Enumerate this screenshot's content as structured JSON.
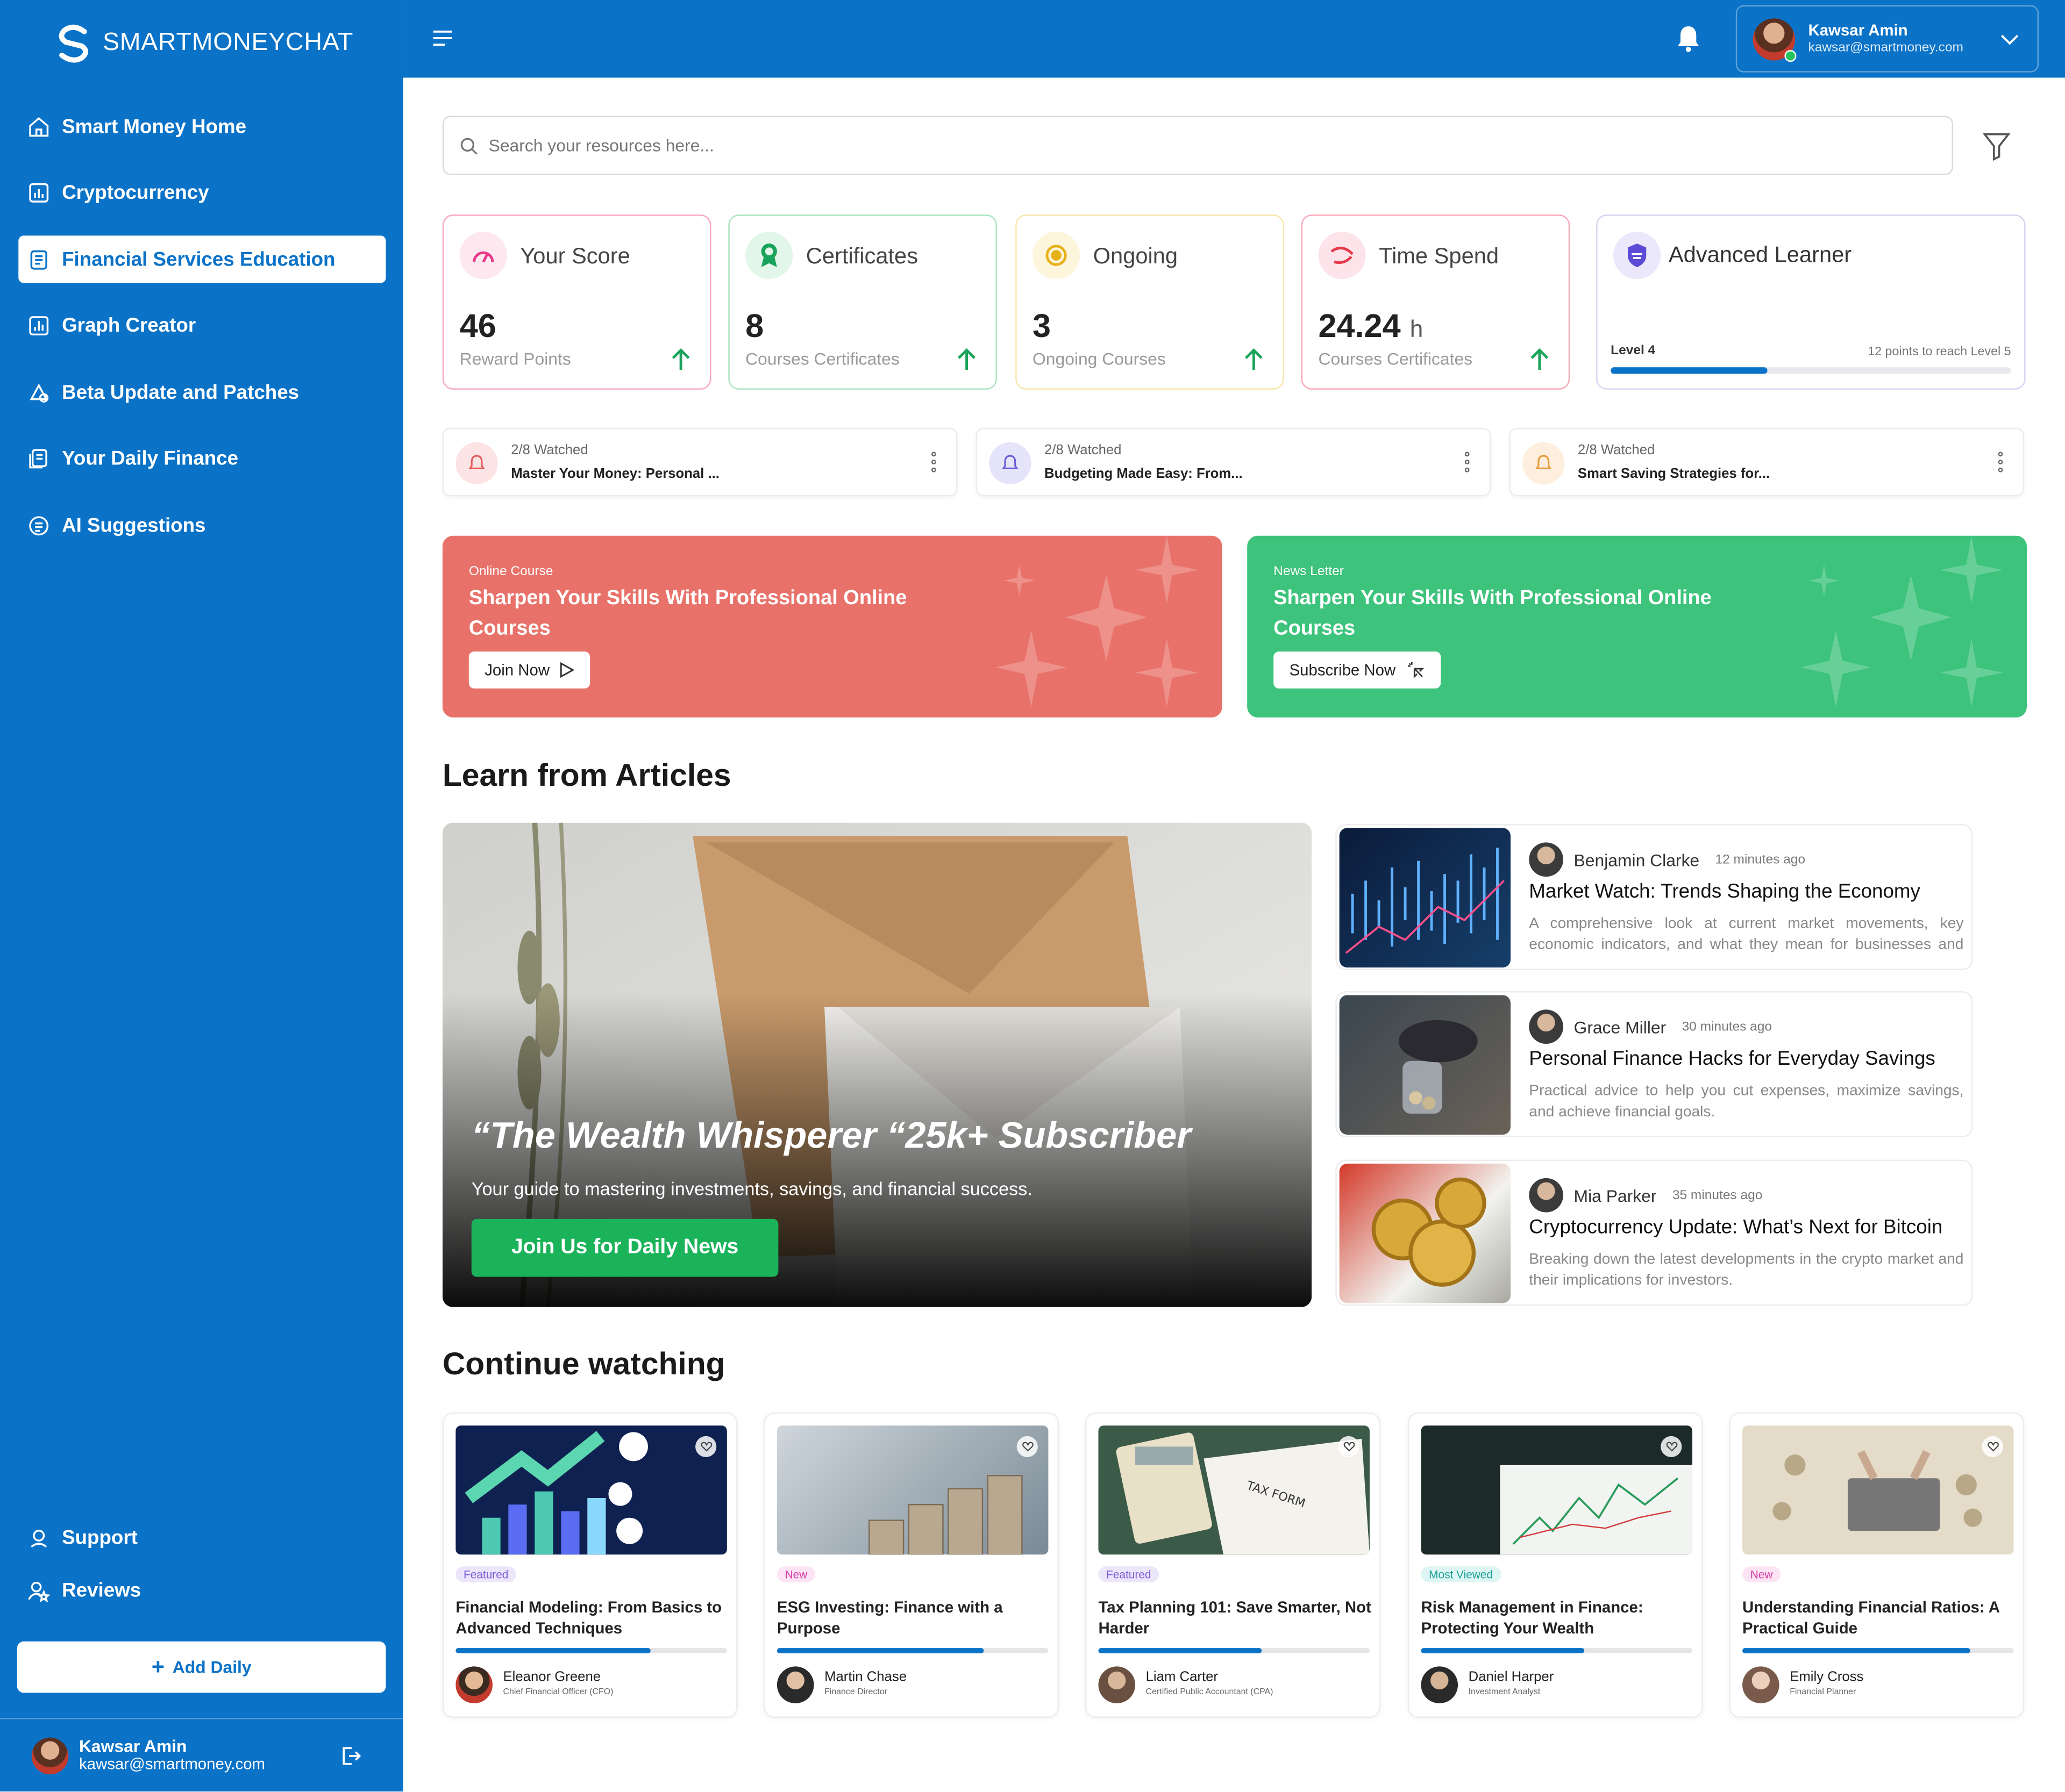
{
  "brand": {
    "name": "SMARTMONEYCHAT"
  },
  "sidebar": {
    "items": [
      {
        "label": "Smart Money Home",
        "icon": "home-icon"
      },
      {
        "label": "Cryptocurrency",
        "icon": "chart-icon"
      },
      {
        "label": "Financial Services Education",
        "icon": "document-icon",
        "active": true
      },
      {
        "label": "Graph Creator",
        "icon": "graph-icon"
      },
      {
        "label": "Beta Update and Patches",
        "icon": "patch-icon"
      },
      {
        "label": "Your Daily Finance",
        "icon": "finance-icon"
      },
      {
        "label": "AI Suggestions",
        "icon": "list-icon"
      }
    ],
    "bottom": [
      {
        "label": "Support",
        "icon": "support-icon"
      },
      {
        "label": "Reviews",
        "icon": "reviews-icon"
      }
    ],
    "add_daily": "Add Daily",
    "user": {
      "name": "Kawsar Amin",
      "email": "kawsar@smartmoney.com"
    }
  },
  "topbar": {
    "user": {
      "name": "Kawsar Amin",
      "email": "kawsar@smartmoney.com"
    }
  },
  "search": {
    "placeholder": "Search your resources here..."
  },
  "stats": [
    {
      "title": "Your Score",
      "value": "46",
      "unit": "",
      "sub": "Reward Points",
      "color": "#f7a8c0"
    },
    {
      "title": "Certificates",
      "value": "8",
      "unit": "",
      "sub": "Courses Certificates",
      "color": "#a9e3c0"
    },
    {
      "title": "Ongoing",
      "value": "3",
      "unit": "",
      "sub": "Ongoing Courses",
      "color": "#f7e6a8"
    },
    {
      "title": "Time Spend",
      "value": "24.24",
      "unit": "h",
      "sub": "Courses Certificates",
      "color": "#f7a8b8"
    }
  ],
  "level": {
    "title": "Advanced Learner",
    "current": "Level 4",
    "next": "12 points to reach Level 5",
    "progress": 0.39
  },
  "watching_now": [
    {
      "watched": "2/8 Watched",
      "title": "Master Your Money: Personal ...",
      "color": "#fde4e4",
      "icon_color": "#e65a5a"
    },
    {
      "watched": "2/8 Watched",
      "title": "Budgeting Made Easy: From...",
      "color": "#e6e4fb",
      "icon_color": "#6c5bd6"
    },
    {
      "watched": "2/8 Watched",
      "title": "Smart Saving Strategies for...",
      "color": "#fdeede",
      "icon_color": "#e69a3a"
    }
  ],
  "banners": [
    {
      "tag": "Online Course",
      "title": "Sharpen  Your Skills With Professional Online Courses",
      "button": "Join Now",
      "color": "#e8726a"
    },
    {
      "tag": "News Letter",
      "title": "Sharpen  Your Skills With Professional Online Courses",
      "button": "Subscribe Now",
      "color": "#3dc37b"
    }
  ],
  "articles_section": {
    "title": "Learn from Articles"
  },
  "hero": {
    "quote": "“The Wealth Whisperer “25k+ Subscriber",
    "subtitle": "Your guide to mastering investments, savings, and financial success.",
    "button": "Join Us for Daily News"
  },
  "articles": [
    {
      "author": "Benjamin Clarke",
      "time": "12 minutes ago",
      "title": "Market Watch: Trends Shaping the Economy",
      "desc": "A comprehensive look at current market movements, key economic indicators, and what they mean for businesses and investors."
    },
    {
      "author": "Grace Miller",
      "time": "30 minutes ago",
      "title": "Personal Finance Hacks for Everyday Savings",
      "desc": "Practical advice to help you cut expenses, maximize savings, and achieve financial goals."
    },
    {
      "author": "Mia Parker",
      "time": "35 minutes ago",
      "title": "Cryptocurrency Update: What’s Next for Bitcoin",
      "desc": "Breaking down the latest developments in the crypto market and their implications for investors."
    }
  ],
  "continue_section": {
    "title": "Continue watching"
  },
  "courses": [
    {
      "badge": "Featured",
      "badge_bg": "#ece6fb",
      "badge_fg": "#7b5bd6",
      "title": "Financial Modeling: From Basics to Advanced Techniques",
      "progress": 0.72,
      "author": "Eleanor Greene",
      "role": "Chief Financial Officer (CFO)"
    },
    {
      "badge": "New",
      "badge_bg": "#fde4f4",
      "badge_fg": "#d63aa8",
      "title": "ESG Investing: Finance with a Purpose",
      "progress": 0.76,
      "author": "Martin Chase",
      "role": "Finance Director"
    },
    {
      "badge": "Featured",
      "badge_bg": "#ece6fb",
      "badge_fg": "#7b5bd6",
      "title": "Tax Planning 101: Save Smarter, Not Harder",
      "progress": 0.6,
      "author": "Liam Carter",
      "role": "Certified Public Accountant (CPA)"
    },
    {
      "badge": "Most Viewed",
      "badge_bg": "#ddf6f4",
      "badge_fg": "#1a9e95",
      "title": "Risk Management in Finance: Protecting Your Wealth",
      "progress": 0.6,
      "author": "Daniel Harper",
      "role": "Investment Analyst"
    },
    {
      "badge": "New",
      "badge_bg": "#fde4f4",
      "badge_fg": "#d63aa8",
      "title": "Understanding Financial Ratios: A Practical Guide",
      "progress": 0.84,
      "author": "Emily Cross",
      "role": "Financial Planner"
    }
  ]
}
